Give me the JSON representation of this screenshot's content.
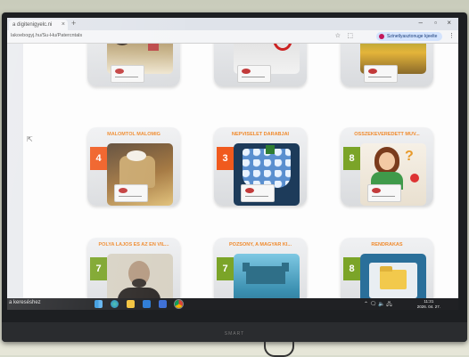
{
  "browser": {
    "tab_title": "a digitenigyelc.ni",
    "tab_close": "×",
    "new_tab": "+",
    "window_controls": [
      "–",
      "▫",
      "×"
    ],
    "url": "lakoebogyj.hu/Su-Hu/Patercntals",
    "star_icon": "☆",
    "extensions_icon": "⬚",
    "profile_label": "Szinetlyasztonuge kjeelte",
    "menu": "⋮"
  },
  "cards": [
    {
      "title": "",
      "badge": "",
      "badge_color": "",
      "image": "guest"
    },
    {
      "title": "",
      "badge": "",
      "badge_color": "",
      "image": "tools"
    },
    {
      "title": "",
      "badge": "",
      "badge_color": "",
      "image": "forest"
    },
    {
      "title": "MALOMTÓL MALOMIG",
      "badge": "4",
      "badge_color": "#f05a1e",
      "image": "flour"
    },
    {
      "title": "NÉPVISELET DARABJAI",
      "badge": "3",
      "badge_color": "#f05a1e",
      "image": "skirt"
    },
    {
      "title": "ÖSSZEKEVEREDETT MŰV...",
      "badge": "8",
      "badge_color": "#7ba428",
      "image": "girl"
    },
    {
      "title": "PÓLYA LAJOS ÉS AZ ÉN VIL...",
      "badge": "7",
      "badge_color": "#7ba428",
      "image": "portrait"
    },
    {
      "title": "POZSONY, A MAGYAR KI...",
      "badge": "7",
      "badge_color": "#7ba428",
      "image": "city"
    },
    {
      "title": "RENDRAKÁS",
      "badge": "8",
      "badge_color": "#7ba428",
      "image": "folder"
    }
  ],
  "taskbar": {
    "left_text": "a kereséshez",
    "tray": "⌃ 🗨 🔈 🖧",
    "time": "11:31",
    "date": "2026. 04. 27."
  },
  "monitor": {
    "brand": "SMART"
  }
}
